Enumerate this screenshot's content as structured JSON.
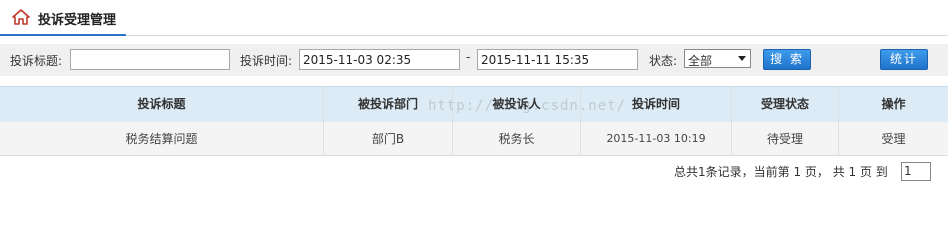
{
  "header": {
    "title": "投诉受理管理"
  },
  "filters": {
    "title_label": "投诉标题:",
    "title_value": "",
    "time_label": "投诉时间:",
    "start_time": "2015-11-03 02:35",
    "range_separator": "-",
    "end_time": "2015-11-11 15:35",
    "status_label": "状态:",
    "status_value": "全部",
    "search_button": "搜 索",
    "stats_button": "统计"
  },
  "table": {
    "columns": [
      "投诉标题",
      "被投诉部门",
      "被投诉人",
      "投诉时间",
      "受理状态",
      "操作"
    ],
    "rows": [
      {
        "title": "税务结算问题",
        "dept": "部门B",
        "person": "税务长",
        "time": "2015-11-03 10:19",
        "status": "待受理",
        "action": "受理"
      }
    ]
  },
  "watermark": "http://blog.csdn.net/",
  "pagination": {
    "summary": "总共1条记录，当前第 1 页， 共 1 页 到",
    "page_input": "1"
  },
  "colors": {
    "accent": "#2a72c5",
    "header_bg": "#dcebf6",
    "button": "#2b83dc"
  }
}
